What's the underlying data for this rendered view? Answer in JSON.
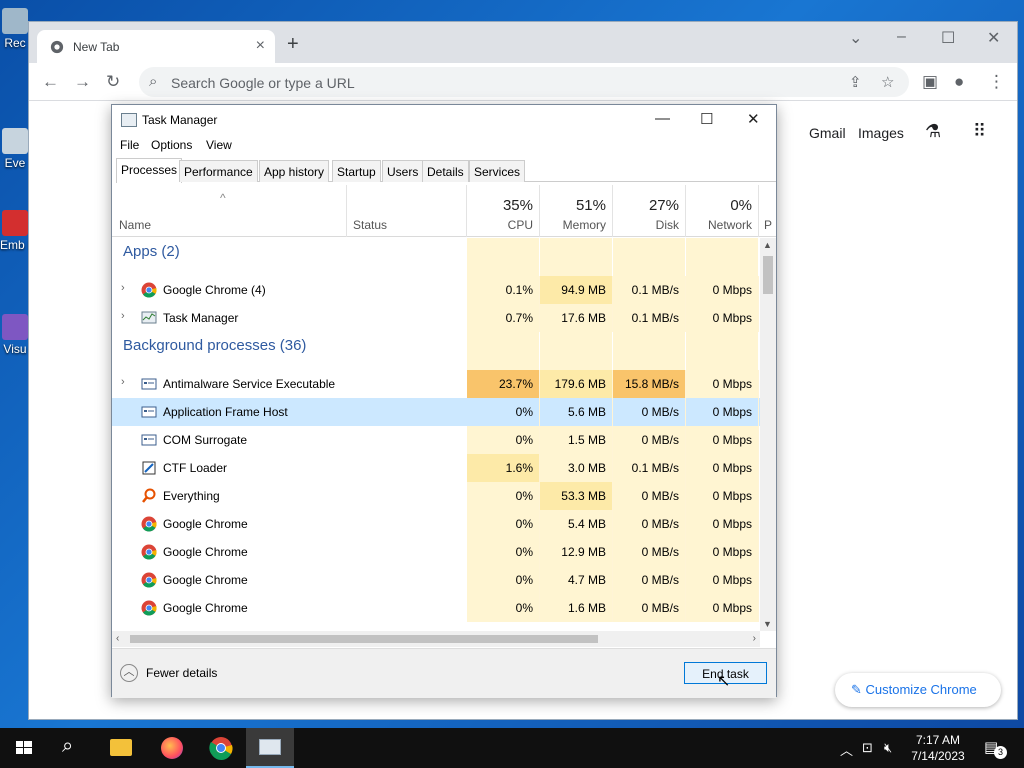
{
  "desktop": {
    "icons": [
      {
        "label": "Rec",
        "icon": "recycle-bin-icon"
      },
      {
        "label": "Eve",
        "icon": "event-viewer-icon"
      },
      {
        "label": "Emb De",
        "icon": "app-icon"
      },
      {
        "label": "Visu",
        "icon": "visual-studio-icon"
      }
    ]
  },
  "chrome": {
    "tab_title": "New Tab",
    "omnibox_placeholder": "Search Google or type a URL",
    "ntp_links": [
      "Gmail",
      "Images"
    ],
    "customize_label": "Customize Chrome"
  },
  "task_manager": {
    "title": "Task Manager",
    "menu": [
      "File",
      "Options",
      "View"
    ],
    "tabs": [
      "Processes",
      "Performance",
      "App history",
      "Startup",
      "Users",
      "Details",
      "Services"
    ],
    "active_tab": "Processes",
    "columns": {
      "name": "Name",
      "status": "Status",
      "cpu_pct": "35%",
      "cpu": "CPU",
      "mem_pct": "51%",
      "mem": "Memory",
      "disk_pct": "27%",
      "disk": "Disk",
      "net_pct": "0%",
      "net": "Network",
      "extra": "P"
    },
    "groups": {
      "apps": "Apps (2)",
      "background": "Background processes (36)"
    },
    "apps": [
      {
        "name": "Google Chrome (4)",
        "icon": "chrome-icon",
        "expandable": true,
        "cpu": "0.1%",
        "mem": "94.9 MB",
        "disk": "0.1 MB/s",
        "net": "0 Mbps"
      },
      {
        "name": "Task Manager",
        "icon": "task-manager-icon",
        "expandable": true,
        "cpu": "0.7%",
        "mem": "17.6 MB",
        "disk": "0.1 MB/s",
        "net": "0 Mbps"
      }
    ],
    "background": [
      {
        "name": "Antimalware Service Executable",
        "icon": "service-icon",
        "expandable": true,
        "cpu": "23.7%",
        "mem": "179.6 MB",
        "disk": "15.8 MB/s",
        "net": "0 Mbps"
      },
      {
        "name": "Application Frame Host",
        "icon": "service-icon",
        "expandable": false,
        "selected": true,
        "cpu": "0%",
        "mem": "5.6 MB",
        "disk": "0 MB/s",
        "net": "0 Mbps"
      },
      {
        "name": "COM Surrogate",
        "icon": "service-icon",
        "expandable": false,
        "cpu": "0%",
        "mem": "1.5 MB",
        "disk": "0 MB/s",
        "net": "0 Mbps"
      },
      {
        "name": "CTF Loader",
        "icon": "ctf-loader-icon",
        "expandable": false,
        "cpu": "1.6%",
        "mem": "3.0 MB",
        "disk": "0.1 MB/s",
        "net": "0 Mbps"
      },
      {
        "name": "Everything",
        "icon": "everything-search-icon",
        "expandable": false,
        "cpu": "0%",
        "mem": "53.3 MB",
        "disk": "0 MB/s",
        "net": "0 Mbps"
      },
      {
        "name": "Google Chrome",
        "icon": "chrome-icon",
        "expandable": false,
        "cpu": "0%",
        "mem": "5.4 MB",
        "disk": "0 MB/s",
        "net": "0 Mbps"
      },
      {
        "name": "Google Chrome",
        "icon": "chrome-icon",
        "expandable": false,
        "cpu": "0%",
        "mem": "12.9 MB",
        "disk": "0 MB/s",
        "net": "0 Mbps"
      },
      {
        "name": "Google Chrome",
        "icon": "chrome-icon",
        "expandable": false,
        "cpu": "0%",
        "mem": "4.7 MB",
        "disk": "0 MB/s",
        "net": "0 Mbps"
      },
      {
        "name": "Google Chrome",
        "icon": "chrome-icon",
        "expandable": false,
        "cpu": "0%",
        "mem": "1.6 MB",
        "disk": "0 MB/s",
        "net": "0 Mbps"
      }
    ],
    "fewer_details": "Fewer details",
    "end_task": "End task"
  },
  "taskbar": {
    "time": "7:17 AM",
    "date": "7/14/2023",
    "notifications": "3",
    "apps": [
      "start-icon",
      "search-icon",
      "file-explorer-icon",
      "firefox-icon",
      "chrome-icon",
      "task-manager-icon"
    ]
  },
  "colors": {
    "heat_light": "#fff5d2",
    "heat_mid": "#fdeaa8",
    "heat_high": "#f9c46b",
    "selection": "#cce8ff",
    "chrome_blue": "#1a73e8"
  }
}
